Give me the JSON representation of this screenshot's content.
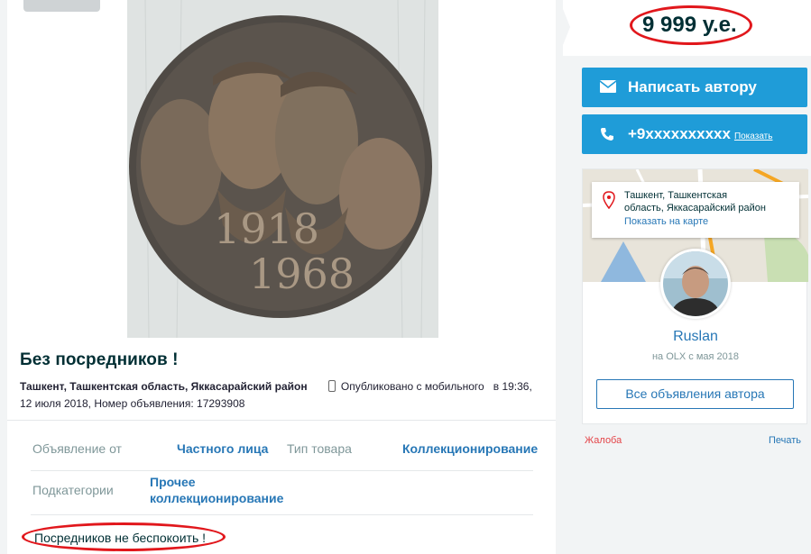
{
  "listing": {
    "title": "Без посредников !",
    "location": "Ташкент, Ташкентская область, Яккасарайский район",
    "published_mobile": "Опубликовано с мобильного",
    "published_time": "в 19:36,",
    "published_date": "12 июля 2018,",
    "ad_number_label": "Номер объявления:",
    "ad_number": "17293908",
    "photo_text": {
      "year1": "1918",
      "year2": "1968"
    },
    "params": {
      "offer_from_label": "Объявление от",
      "offer_from_value": "Частного лица",
      "product_type_label": "Тип товара",
      "product_type_value": "Коллекционирование",
      "subcategory_label": "Подкатегории",
      "subcategory_value_1": "Прочее",
      "subcategory_value_2": "коллекционирование"
    },
    "description": "Посредников не беспокоить !"
  },
  "sidebar": {
    "price": "9 999 у.е.",
    "message_button": "Написать автору",
    "phone": "+9xxxxxxxxxx",
    "phone_show": "Показать",
    "map": {
      "address_line1": "Ташкент, Ташкентская",
      "address_line2": "область, Яккасарайский район",
      "show_on_map": "Показать на карте"
    },
    "user": {
      "name": "Ruslan",
      "since": "на OLX с мая 2018",
      "all_ads_button": "Все объявления автора"
    },
    "report_link": "Жалоба",
    "print_link": "Печать"
  },
  "colors": {
    "accent": "#1f9cd8",
    "link": "#2777b6",
    "annotation_red": "#e1171c",
    "dark_text": "#002f34"
  },
  "icons": [
    "envelope-icon",
    "phone-icon",
    "map-pin-icon",
    "mobile-icon"
  ]
}
